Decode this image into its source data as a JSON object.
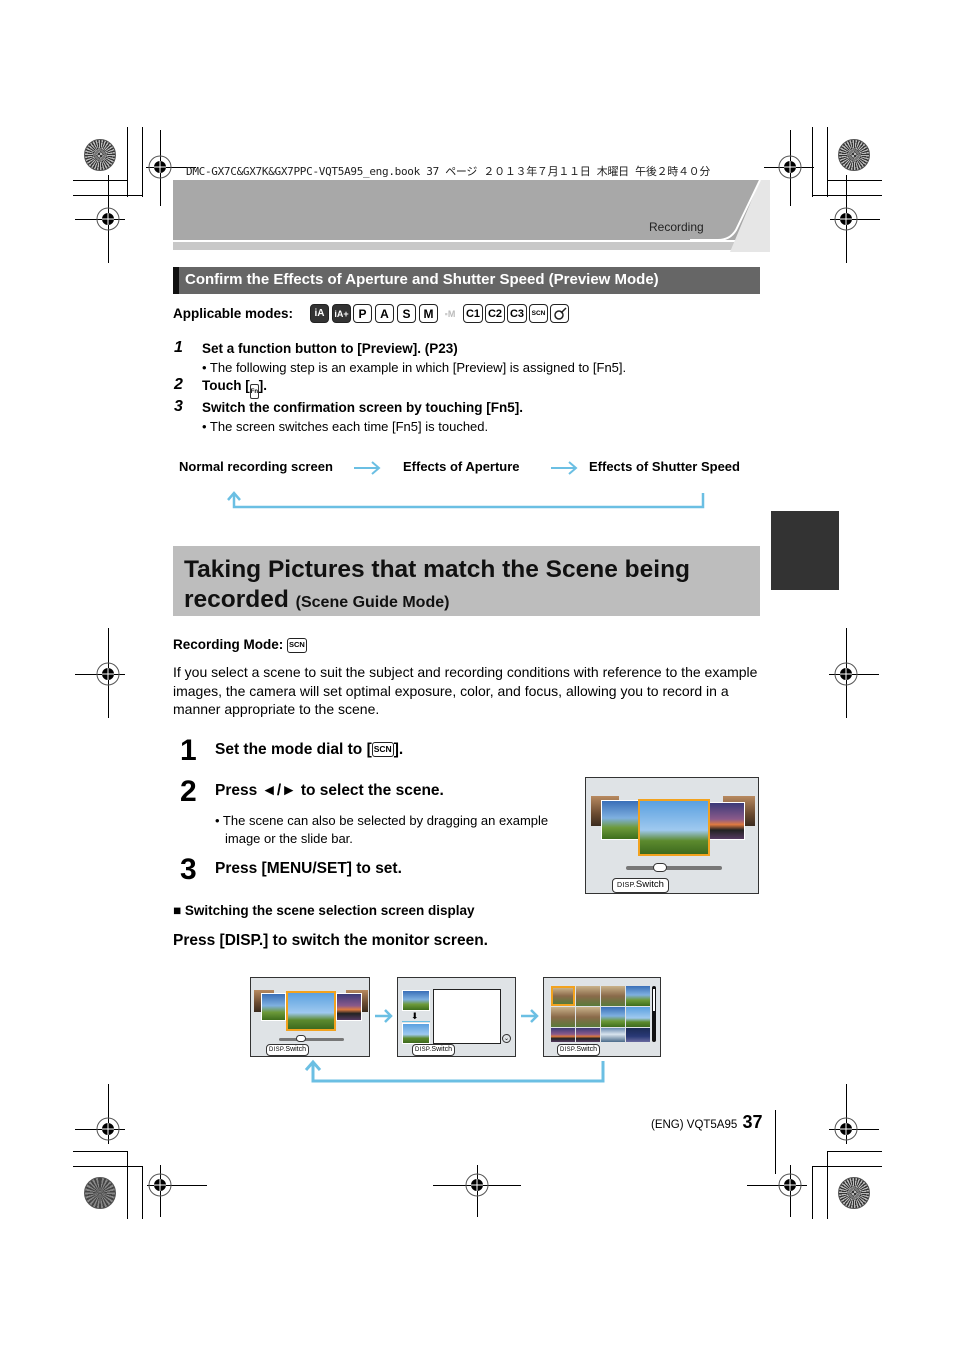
{
  "print_meta": {
    "file_line": "DMC-GX7C&GX7K&GX7PPC-VQT5A95_eng.book  37 ページ  ２０１３年７月１１日  木曜日  午後２時４０分"
  },
  "header": {
    "section_tag": "Recording"
  },
  "preview_section": {
    "title": "Confirm the Effects of Aperture and Shutter Speed (Preview Mode)",
    "applicable_modes_label": "Applicable modes:",
    "modes": [
      {
        "label": "iA",
        "state": "enabled",
        "icon": "intelligent-auto-icon"
      },
      {
        "label": "iA+",
        "state": "enabled",
        "icon": "intelligent-auto-plus-icon"
      },
      {
        "label": "P",
        "state": "enabled",
        "icon": "program-mode-icon"
      },
      {
        "label": "A",
        "state": "enabled",
        "icon": "aperture-priority-icon"
      },
      {
        "label": "S",
        "state": "enabled",
        "icon": "shutter-priority-icon"
      },
      {
        "label": "M",
        "state": "enabled",
        "icon": "manual-mode-icon"
      },
      {
        "label": "M",
        "state": "disabled",
        "icon": "creative-video-icon"
      },
      {
        "label": "C1",
        "state": "enabled",
        "icon": "custom-1-icon"
      },
      {
        "label": "C2",
        "state": "enabled",
        "icon": "custom-2-icon"
      },
      {
        "label": "C3",
        "state": "enabled",
        "icon": "custom-3-icon"
      },
      {
        "label": "SCN",
        "state": "enabled",
        "icon": "scene-guide-icon"
      },
      {
        "label": "",
        "state": "enabled",
        "icon": "creative-control-icon"
      }
    ],
    "steps": [
      {
        "num": "1",
        "text": "Set a function button to [Preview]. (P23)",
        "note": "• The following step is an example in which [Preview] is assigned to [Fn5]."
      },
      {
        "num": "2",
        "text_before": "Touch [",
        "icon_text": "Fn",
        "text_after": "].",
        "note": ""
      },
      {
        "num": "3",
        "text": "Switch the confirmation screen by touching [Fn5].",
        "note": "• The screen switches each time [Fn5] is touched."
      }
    ],
    "flow": [
      "Normal recording screen",
      "Effects of Aperture",
      "Effects of Shutter Speed"
    ]
  },
  "scene_section": {
    "title": "Taking Pictures that match the Scene being recorded",
    "title_line1": "Taking Pictures that match the Scene being",
    "title_line2": "recorded",
    "subtitle": "(Scene Guide Mode)",
    "side_tab_color": "#333333",
    "recording_mode_label": "Recording Mode:",
    "recording_mode_icon": "SCN",
    "intro": "If you select a scene to suit the subject and recording conditions with reference to the example images, the camera will set optimal exposure, color, and focus, allowing you to record in a manner appropriate to the scene.",
    "steps": [
      {
        "num": "1",
        "text_before": "Set the mode dial to [",
        "icon_text": "SCN",
        "text_after": "]."
      },
      {
        "num": "2",
        "text": "Press ◄/► to select the scene.",
        "note_line1": "• The scene can also be selected by dragging an example",
        "note_line2": "image or the slide bar."
      },
      {
        "num": "3",
        "text": "Press [MENU/SET] to set."
      }
    ],
    "lcd_example": {
      "disp_prefix": "DISP.",
      "disp_label": "Switch",
      "slider_position": 0.35
    },
    "switching": {
      "heading": "■ Switching the scene selection screen display",
      "instruction": "Press [DISP.] to switch the monitor screen.",
      "screens": [
        "carousel-view",
        "list-view",
        "thumbnail-grid-view"
      ],
      "disp_prefix": "DISP.",
      "disp_label": "Switch"
    },
    "accent_color": "#6bbfe3",
    "highlight_color": "#f2a21e"
  },
  "footer": {
    "code": "(ENG) VQT5A95",
    "page_number": "37"
  }
}
